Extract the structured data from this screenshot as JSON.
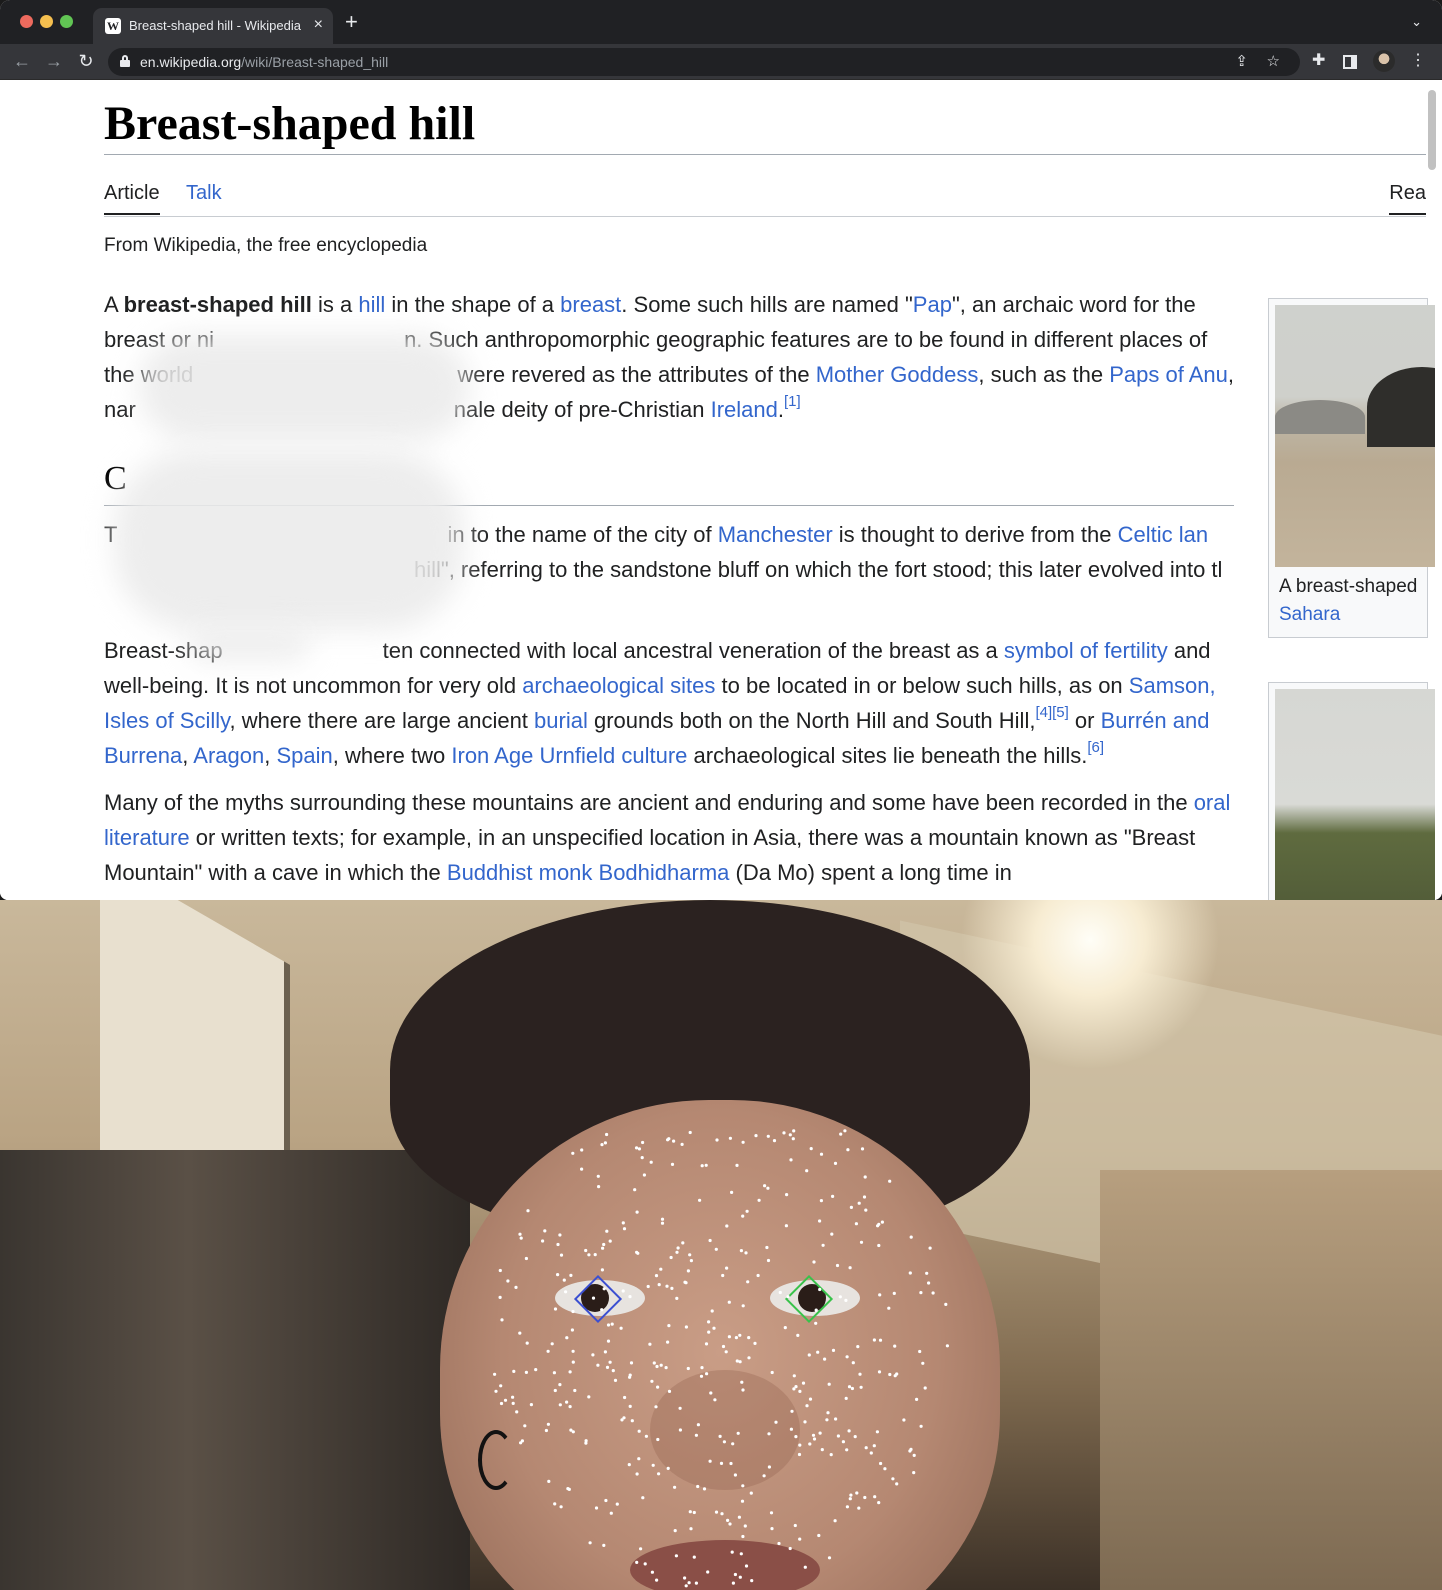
{
  "browser": {
    "tab_title": "Breast-shaped hill - Wikipedia",
    "tab_favicon": "W",
    "url_host": "en.wikipedia.org",
    "url_path": "/wiki/Breast-shaped_hill",
    "icons": [
      "back-icon",
      "forward-icon",
      "reload-icon",
      "lock-icon",
      "share-icon",
      "star-icon",
      "extensions-icon",
      "side-panel-icon",
      "profile-avatar",
      "menu-icon"
    ]
  },
  "article": {
    "title": "Breast-shaped hill",
    "tab_article": "Article",
    "tab_talk": "Talk",
    "tab_read": "Rea",
    "tagline": "From Wikipedia, the free encyclopedia",
    "p1": {
      "t1": "A ",
      "bold": "breast-shaped hill",
      "t2": " is a ",
      "l_hill": "hill",
      "t3": " in the shape of a ",
      "l_breast": "breast",
      "t4": ". Some such hills are named \"",
      "l_pap": "Pap",
      "t5": "\", an archaic word for the breast or ni",
      "t6": "n. Such anthropomorphic geographic features are to be found in different places of the world",
      "t7": " were revered as the attributes of the ",
      "l_mother": "Mother Goddess",
      "t8": ", such as the ",
      "l_paps": "Paps of Anu",
      "t9": ", nar",
      "t10": "nale deity of pre-Christian ",
      "l_ireland": "Ireland",
      "t11": ".",
      "ref1": "[1]"
    },
    "overview_heading": "C",
    "p2": {
      "t1": "T",
      "t2": "in to the name of the city of ",
      "l_manchester": "Manchester",
      "t3": " is thought to derive from the ",
      "l_celtic": "Celtic",
      "l_lan": "lan",
      "t4": "hill\", referring to the sandstone bluff on which the fort stood; this later evolved into tl"
    },
    "p3": {
      "t1": "Breast-shap",
      "t2": "ten connected with local ancestral veneration of the breast as a ",
      "l_fertility": "symbol of fertility",
      "t3": " and well-being. It is not uncommon for very old ",
      "l_arch": "archaeological sites",
      "t4": " to be located in or below such hills, as on ",
      "l_samson": "Samson, Isles of Scilly",
      "t5": ", where there are large ancient ",
      "l_burial": "burial",
      "t6": " grounds both on the North Hill and South Hill,",
      "ref45": "[4][5]",
      "t7": " or ",
      "l_burren": "Burrén and Burrena",
      "t8": ", ",
      "l_aragon": "Aragon",
      "t9": ", ",
      "l_spain": "Spain",
      "t10": ", where two ",
      "l_urnfield": "Iron Age Urnfield culture",
      "t11": " archaeological sites lie beneath the hills.",
      "ref6": "[6]"
    },
    "p4": {
      "t1": "Many of the myths surrounding these mountains are ancient and enduring and some have been recorded in the ",
      "l_oral": "oral literature",
      "t2": " or written texts; for example, in an unspecified location in Asia, there was a mountain known as \"Breast Mountain\" with a cave in which the ",
      "l_bodhi": "Buddhist monk Bodhidharma",
      "t3": " (Da Mo) spent a long time in"
    },
    "thumb1_caption": "A breast-shaped",
    "thumb1_link": "Sahara"
  },
  "colors": {
    "link": "#3366cc",
    "text": "#202122",
    "gaze_left": "#3b4fd1",
    "gaze_right": "#38c24a"
  }
}
